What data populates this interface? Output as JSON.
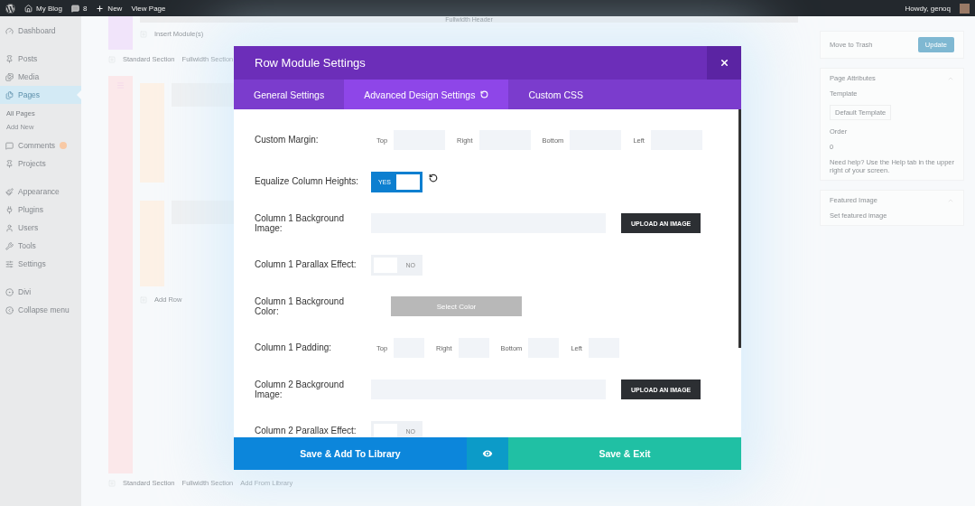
{
  "admin_bar": {
    "site": "My Blog",
    "comments": "8",
    "new": "New",
    "view": "View Page",
    "greeting": "Howdy, genoq"
  },
  "sidebar": {
    "groups": [
      {
        "items": [
          {
            "label": "Dashboard",
            "selected": false
          }
        ]
      },
      {
        "items": [
          {
            "label": "Posts",
            "selected": false
          },
          {
            "label": "Media",
            "selected": false
          },
          {
            "label": "Pages",
            "selected": true,
            "children": [
              {
                "label": "All Pages",
                "selected": true
              },
              {
                "label": "Add New",
                "selected": false
              }
            ]
          },
          {
            "label": "Comments",
            "selected": false,
            "badge": true
          },
          {
            "label": "Projects",
            "selected": false
          }
        ]
      },
      {
        "items": [
          {
            "label": "Appearance",
            "selected": false
          },
          {
            "label": "Plugins",
            "selected": false
          },
          {
            "label": "Users",
            "selected": false
          },
          {
            "label": "Tools",
            "selected": false
          },
          {
            "label": "Settings",
            "selected": false
          }
        ]
      },
      {
        "items": [
          {
            "label": "Divi",
            "selected": false
          },
          {
            "label": "Collapse menu",
            "selected": false
          }
        ]
      }
    ]
  },
  "builder": {
    "header_module": "Fullwidth Header",
    "insert_module": "Insert Module(s)",
    "section_links": [
      "Standard Section",
      "Fullwidth Section"
    ],
    "add_row": "Add Row",
    "bottom_links": [
      "Standard Section",
      "Fullwidth Section",
      "Add From Library"
    ]
  },
  "right_panel": {
    "trash": "Move to Trash",
    "update": "Update",
    "attributes_title": "Page Attributes",
    "template_label": "Template",
    "template_value": "Default Template",
    "order_label": "Order",
    "order_value": "0",
    "help": "Need help? Use the Help tab in the upper right of your screen.",
    "featured_title": "Featured Image",
    "featured_link": "Set featured image"
  },
  "modal": {
    "title": "Row Module Settings",
    "tabs": [
      {
        "label": "General Settings",
        "selected": false,
        "modified": false
      },
      {
        "label": "Advanced Design Settings",
        "selected": true,
        "modified": true
      },
      {
        "label": "Custom CSS",
        "selected": false,
        "modified": false
      }
    ],
    "rows": [
      {
        "kind": "margin",
        "label": "Custom Margin:",
        "fields": [
          "Top",
          "Right",
          "Bottom",
          "Left"
        ]
      },
      {
        "kind": "toggle",
        "label": "Equalize Column Heights:",
        "on": true,
        "state_label": "YES",
        "modified": true
      },
      {
        "kind": "upload",
        "label": "Column 1 Background Image:",
        "button": "UPLOAD AN IMAGE"
      },
      {
        "kind": "toggle",
        "label": "Column 1 Parallax Effect:",
        "on": false,
        "state_label": "NO",
        "modified": false
      },
      {
        "kind": "color",
        "label": "Column 1 Background Color:",
        "button": "Select Color"
      },
      {
        "kind": "padding",
        "label": "Column 1 Padding:",
        "fields": [
          "Top",
          "Right",
          "Bottom",
          "Left"
        ]
      },
      {
        "kind": "upload",
        "label": "Column 2 Background Image:",
        "button": "UPLOAD AN IMAGE"
      },
      {
        "kind": "toggle",
        "label": "Column 2 Parallax Effect:",
        "on": false,
        "state_label": "NO",
        "modified": false
      }
    ],
    "footer": {
      "library": "Save & Add To Library",
      "exit": "Save & Exit"
    }
  }
}
